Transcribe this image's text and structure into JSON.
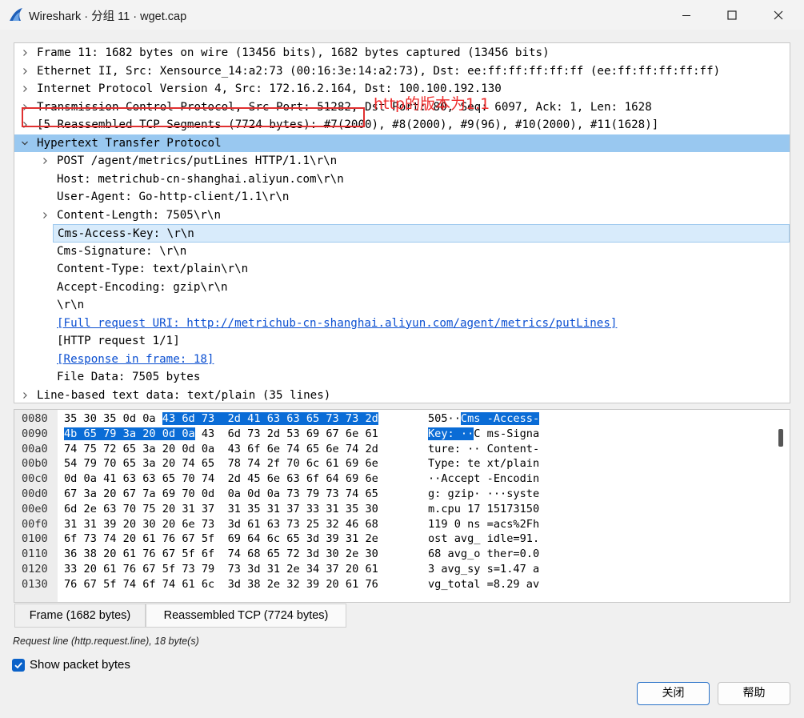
{
  "window": {
    "title": "Wireshark · 分组 11 · wget.cap"
  },
  "tree": [
    {
      "text": "Frame 11: 1682 bytes on wire (13456 bits), 1682 bytes captured (13456 bits)",
      "expander": "collapsed",
      "level": 0
    },
    {
      "text": "Ethernet II, Src: Xensource_14:a2:73 (00:16:3e:14:a2:73), Dst: ee:ff:ff:ff:ff:ff (ee:ff:ff:ff:ff:ff)",
      "expander": "collapsed",
      "level": 0
    },
    {
      "text": "Internet Protocol Version 4, Src: 172.16.2.164, Dst: 100.100.192.130",
      "expander": "collapsed",
      "level": 0
    },
    {
      "text": "Transmission Control Protocol, Src Port: 51282, Dst Port: 80, Seq: 6097, Ack: 1, Len: 1628",
      "expander": "collapsed",
      "level": 0
    },
    {
      "text": "[5 Reassembled TCP Segments (7724 bytes): #7(2000), #8(2000), #9(96), #10(2000), #11(1628)]",
      "expander": "collapsed",
      "level": 0
    },
    {
      "text": "Hypertext Transfer Protocol",
      "expander": "expanded",
      "level": 0,
      "state": "selected"
    },
    {
      "text": "POST /agent/metrics/putLines HTTP/1.1\\r\\n",
      "expander": "collapsed",
      "level": 1
    },
    {
      "text": "Host: metrichub-cn-shanghai.aliyun.com\\r\\n",
      "expander": "none",
      "level": 1
    },
    {
      "text": "User-Agent: Go-http-client/1.1\\r\\n",
      "expander": "none",
      "level": 1
    },
    {
      "text": "Content-Length: 7505\\r\\n",
      "expander": "collapsed",
      "level": 1
    },
    {
      "text": "Cms-Access-Key: \\r\\n",
      "expander": "none",
      "level": 1,
      "state": "hover"
    },
    {
      "text": "Cms-Signature: \\r\\n",
      "expander": "none",
      "level": 1
    },
    {
      "text": "Content-Type: text/plain\\r\\n",
      "expander": "none",
      "level": 1
    },
    {
      "text": "Accept-Encoding: gzip\\r\\n",
      "expander": "none",
      "level": 1
    },
    {
      "text": "\\r\\n",
      "expander": "none",
      "level": 1
    },
    {
      "text": "[Full request URI: http://metrichub-cn-shanghai.aliyun.com/agent/metrics/putLines]",
      "expander": "none",
      "level": 1,
      "link": true
    },
    {
      "text": "[HTTP request 1/1]",
      "expander": "none",
      "level": 1
    },
    {
      "text": "[Response in frame: 18]",
      "expander": "none",
      "level": 1,
      "link": true
    },
    {
      "text": "File Data: 7505 bytes",
      "expander": "none",
      "level": 1
    },
    {
      "text": "Line-based text data: text/plain (35 lines)",
      "expander": "collapsed",
      "level": 0
    }
  ],
  "annotation": "http的版本为1.1",
  "bytes": [
    {
      "offset": "0080",
      "hex": [
        [
          "35 30 35 0d 0a ",
          false
        ],
        [
          "43 6d 73  2d 41 63 63 65 73 73 2d",
          true
        ]
      ],
      "ascii": [
        [
          "505··",
          false
        ],
        [
          "Cms -Access-",
          true
        ]
      ]
    },
    {
      "offset": "0090",
      "hex": [
        [
          "4b 65 79 3a 20 0d 0a",
          true
        ],
        [
          " 43  6d 73 2d 53 69 67 6e 61",
          false
        ]
      ],
      "ascii": [
        [
          "Key: ··",
          true
        ],
        [
          "C ms-Signa",
          false
        ]
      ]
    },
    {
      "offset": "00a0",
      "hex": [
        [
          "74 75 72 65 3a 20 0d 0a  43 6f 6e 74 65 6e 74 2d",
          false
        ]
      ],
      "ascii": [
        [
          "ture: ·· Content-",
          false
        ]
      ]
    },
    {
      "offset": "00b0",
      "hex": [
        [
          "54 79 70 65 3a 20 74 65  78 74 2f 70 6c 61 69 6e",
          false
        ]
      ],
      "ascii": [
        [
          "Type: te xt/plain",
          false
        ]
      ]
    },
    {
      "offset": "00c0",
      "hex": [
        [
          "0d 0a 41 63 63 65 70 74  2d 45 6e 63 6f 64 69 6e",
          false
        ]
      ],
      "ascii": [
        [
          "··Accept -Encodin",
          false
        ]
      ]
    },
    {
      "offset": "00d0",
      "hex": [
        [
          "67 3a 20 67 7a 69 70 0d  0a 0d 0a 73 79 73 74 65",
          false
        ]
      ],
      "ascii": [
        [
          "g: gzip· ···syste",
          false
        ]
      ]
    },
    {
      "offset": "00e0",
      "hex": [
        [
          "6d 2e 63 70 75 20 31 37  31 35 31 37 33 31 35 30",
          false
        ]
      ],
      "ascii": [
        [
          "m.cpu 17 15173150",
          false
        ]
      ]
    },
    {
      "offset": "00f0",
      "hex": [
        [
          "31 31 39 20 30 20 6e 73  3d 61 63 73 25 32 46 68",
          false
        ]
      ],
      "ascii": [
        [
          "119 0 ns =acs%2Fh",
          false
        ]
      ]
    },
    {
      "offset": "0100",
      "hex": [
        [
          "6f 73 74 20 61 76 67 5f  69 64 6c 65 3d 39 31 2e",
          false
        ]
      ],
      "ascii": [
        [
          "ost avg_ idle=91.",
          false
        ]
      ]
    },
    {
      "offset": "0110",
      "hex": [
        [
          "36 38 20 61 76 67 5f 6f  74 68 65 72 3d 30 2e 30",
          false
        ]
      ],
      "ascii": [
        [
          "68 avg_o ther=0.0",
          false
        ]
      ]
    },
    {
      "offset": "0120",
      "hex": [
        [
          "33 20 61 76 67 5f 73 79  73 3d 31 2e 34 37 20 61",
          false
        ]
      ],
      "ascii": [
        [
          "3 avg_sy s=1.47 a",
          false
        ]
      ]
    },
    {
      "offset": "0130",
      "hex": [
        [
          "76 67 5f 74 6f 74 61 6c  3d 38 2e 32 39 20 61 76",
          false
        ]
      ],
      "ascii": [
        [
          "vg_total =8.29 av",
          false
        ]
      ]
    }
  ],
  "tabs": [
    {
      "label": "Frame (1682 bytes)",
      "active": false
    },
    {
      "label": "Reassembled TCP (7724 bytes)",
      "active": true
    }
  ],
  "status": "Request line (http.request.line), 18 byte(s)",
  "show_packet_bytes": {
    "label": "Show packet bytes",
    "checked": true
  },
  "buttons": {
    "close": "关闭",
    "help": "帮助"
  },
  "colors": {
    "selection": "#99c8f0",
    "hover": "#d8ebfb",
    "byte_highlight": "#0a6cd6",
    "link": "#0b4fd1",
    "annotation": "#ee2b2b",
    "checkbox": "#0a62c9"
  }
}
